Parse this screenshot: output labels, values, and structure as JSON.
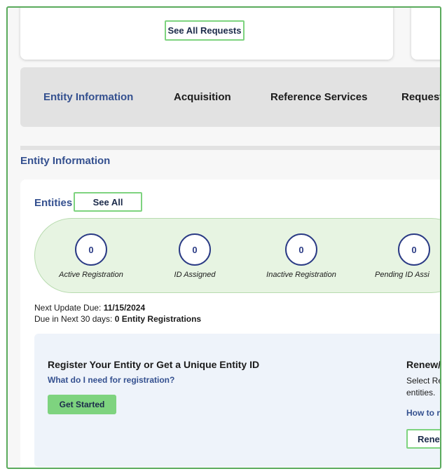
{
  "top_card": {
    "see_all_requests_label": "See All Requests"
  },
  "tabs": [
    {
      "label": "Entity Information",
      "active": true
    },
    {
      "label": "Acquisition",
      "active": false
    },
    {
      "label": "Reference Services",
      "active": false
    },
    {
      "label": "Request",
      "active": false
    }
  ],
  "section_title": "Entity Information",
  "entities": {
    "title": "Entities",
    "see_all_label": "See All",
    "stats": [
      {
        "value": "0",
        "label": "Active Registration"
      },
      {
        "value": "0",
        "label": "ID Assigned"
      },
      {
        "value": "0",
        "label": "Inactive Registration"
      },
      {
        "value": "0",
        "label": "Pending ID Assi"
      }
    ],
    "next_update_label": "Next Update Due:",
    "next_update_value": "11/15/2024",
    "due_label": "Due in Next 30 days:",
    "due_value": "0 Entity Registrations"
  },
  "register": {
    "title": "Register Your Entity or Get a Unique Entity ID",
    "link": "What do I need for registration?",
    "button": "Get Started"
  },
  "renew": {
    "title": "Renew/",
    "desc_line1": "Select Re",
    "desc_line2": "entities.",
    "link": "How to re",
    "button": "Renew"
  },
  "colors": {
    "accent_blue": "#34508f",
    "accent_green": "#7ed37f",
    "frame_border": "#5aaa5c",
    "pill_bg": "#e7f4e2",
    "register_bg": "#eef3fa"
  }
}
